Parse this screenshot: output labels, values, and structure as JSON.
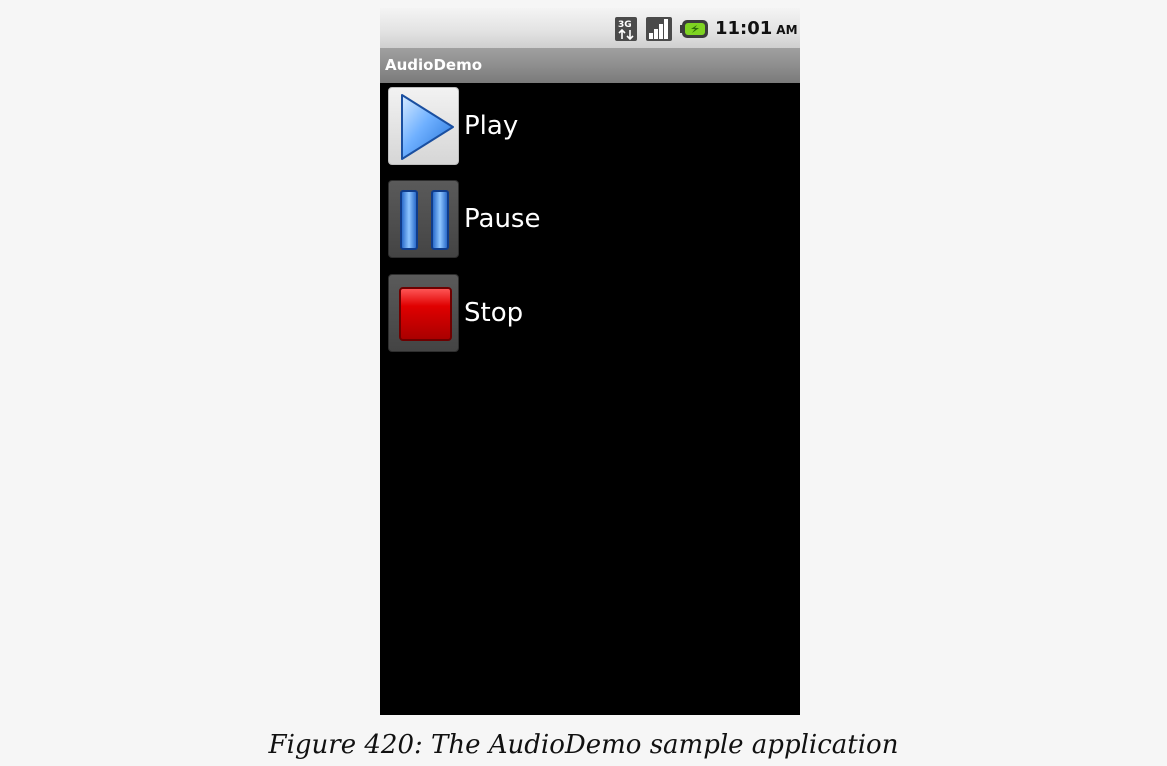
{
  "status_bar": {
    "icons": [
      "3g-network-icon",
      "signal-strength-icon",
      "battery-icon"
    ],
    "time": "11:01",
    "ampm": "AM"
  },
  "app": {
    "title": "AudioDemo"
  },
  "controls": [
    {
      "label": "Play",
      "icon": "play-icon",
      "state": "pressed"
    },
    {
      "label": "Pause",
      "icon": "pause-icon",
      "state": "normal"
    },
    {
      "label": "Stop",
      "icon": "stop-icon",
      "state": "normal"
    }
  ],
  "caption": "Figure 420: The AudioDemo sample application",
  "colors": {
    "screen_background": "#000000",
    "title_bar": "#8c8c8c",
    "play_icon": "#3a8ff0",
    "pause_icon": "#3a8ff0",
    "stop_icon": "#cc0000"
  }
}
